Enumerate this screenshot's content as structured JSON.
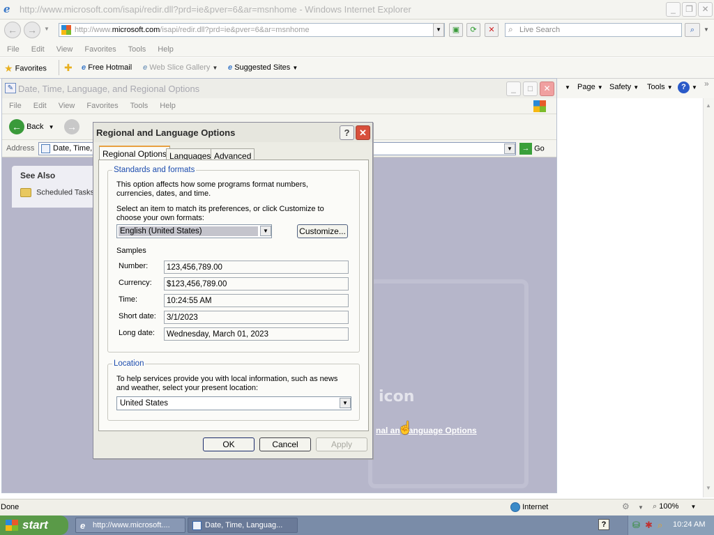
{
  "ie": {
    "title": "http://www.microsoft.com/isapi/redir.dll?prd=ie&pver=6&ar=msnhome - Windows Internet Explorer",
    "address_prefix": "http://www.",
    "address_domain": "microsoft.com",
    "address_suffix": "/isapi/redir.dll?prd=ie&pver=6&ar=msnhome",
    "search_placeholder": "Live Search",
    "menu": [
      "File",
      "Edit",
      "View",
      "Favorites",
      "Tools",
      "Help"
    ],
    "favorites_label": "Favorites",
    "fav_links": [
      "Free Hotmail",
      "Web Slice Gallery",
      "Suggested Sites"
    ],
    "cmd": [
      "Page",
      "Safety",
      "Tools"
    ],
    "status_left": "Done",
    "zone": "Internet",
    "zoom": "100%"
  },
  "cp": {
    "title": "Date, Time, Language, and Regional Options",
    "menu": [
      "File",
      "Edit",
      "View",
      "Favorites",
      "Tools",
      "Help"
    ],
    "back_label": "Back",
    "address_label": "Address",
    "address_value": "Date, Time,",
    "go_label": "Go",
    "see_also": "See Also",
    "scheduled_tasks": "Scheduled Tasks",
    "bg_text_icon": "icon",
    "bg_link_part1": "nal an",
    "bg_link_part2": "anguage Options"
  },
  "dialog": {
    "title": "Regional and Language Options",
    "tabs": [
      "Regional Options",
      "Languages",
      "Advanced"
    ],
    "std_legend": "Standards and formats",
    "std_desc": "This option affects how some programs format numbers, currencies, dates, and time.",
    "std_select_desc": "Select an item to match its preferences, or click Customize to choose your own formats:",
    "locale": "English (United States)",
    "customize": "Customize...",
    "samples_label": "Samples",
    "samples": [
      {
        "label": "Number:",
        "value": "123,456,789.00"
      },
      {
        "label": "Currency:",
        "value": "$123,456,789.00"
      },
      {
        "label": "Time:",
        "value": "10:24:55 AM"
      },
      {
        "label": "Short date:",
        "value": "3/1/2023"
      },
      {
        "label": "Long date:",
        "value": "Wednesday, March 01, 2023"
      }
    ],
    "loc_legend": "Location",
    "loc_desc": "To help services provide you with local information, such as news and weather, select your present location:",
    "location": "United States",
    "ok": "OK",
    "cancel": "Cancel",
    "apply": "Apply"
  },
  "taskbar": {
    "start": "start",
    "tasks": [
      "http://www.microsoft....",
      "Date, Time, Languag..."
    ],
    "clock": "10:24 AM"
  },
  "colors": {
    "link_blue": "#1c4cae",
    "start_green": "#5a9a48",
    "taskbar": "#7a8ca8"
  }
}
